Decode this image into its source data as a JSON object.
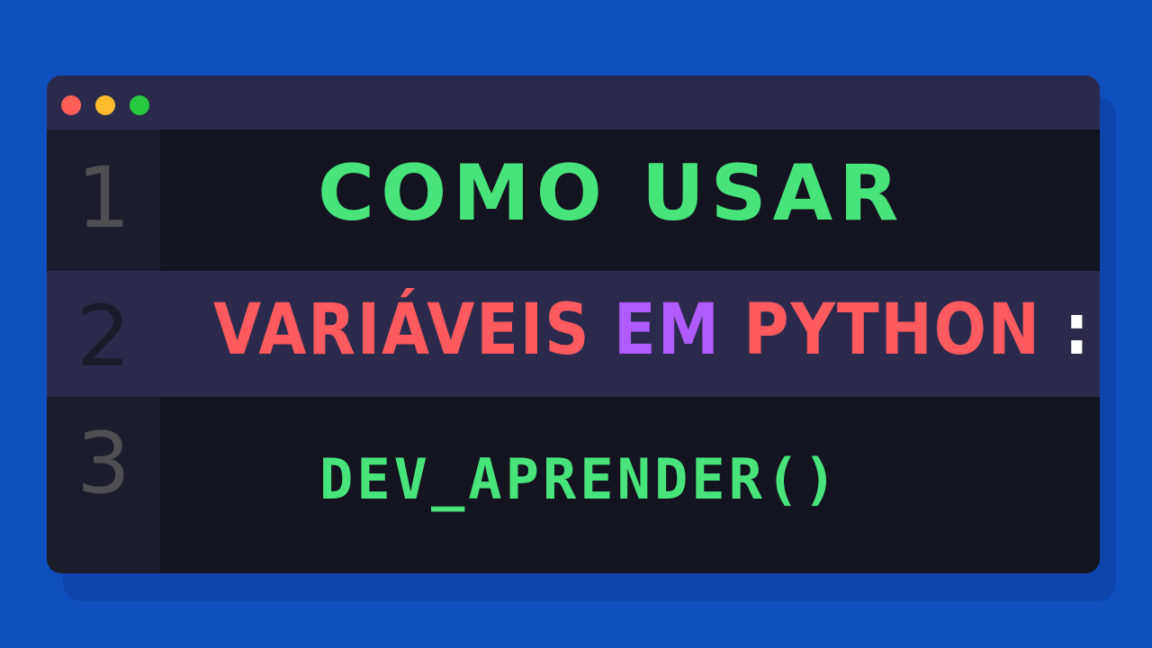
{
  "window": {
    "controls": {
      "close": "red-dot",
      "minimize": "yellow-dot",
      "maximize": "green-dot"
    },
    "lines": [
      {
        "number": "1",
        "text": "COMO USAR"
      },
      {
        "number": "2",
        "text_parts": [
          {
            "text": "VARIÁVEIS ",
            "color": "#ff5a5f"
          },
          {
            "text": "EM ",
            "color": "#b05bff"
          },
          {
            "text": "PYTHON ",
            "color": "#ff5a5f"
          },
          {
            "text": ":",
            "color": "#ffffff"
          }
        ]
      },
      {
        "number": "3",
        "text": "DEV_APRENDER()"
      }
    ]
  },
  "colors": {
    "background": "#0f4fbd",
    "editor": "#13141f",
    "titlebar": "#2b2a4c",
    "highlight_line": "#2b2a4c",
    "green": "#49e37b",
    "red": "#ff5a5f",
    "purple": "#b05bff"
  }
}
